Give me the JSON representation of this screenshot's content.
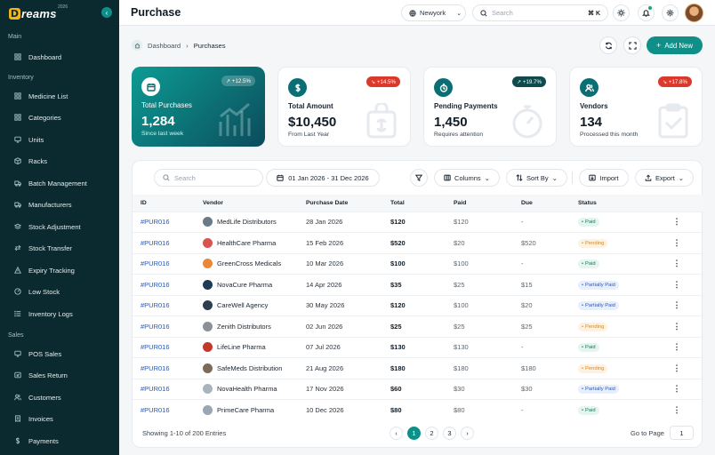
{
  "brand": {
    "name": "reams",
    "mark": "D",
    "year": "2026"
  },
  "sidebar": {
    "sections": [
      {
        "label": "Main",
        "items": [
          {
            "label": "Dashboard",
            "icon": "grid-icon"
          }
        ]
      },
      {
        "label": "Inventory",
        "items": [
          {
            "label": "Medicine List",
            "icon": "grid-icon"
          },
          {
            "label": "Categories",
            "icon": "grid-icon"
          },
          {
            "label": "Units",
            "icon": "monitor-icon"
          },
          {
            "label": "Racks",
            "icon": "box-icon"
          },
          {
            "label": "Batch Management",
            "icon": "truck-icon"
          },
          {
            "label": "Manufacturers",
            "icon": "truck-icon"
          },
          {
            "label": "Stock Adjustment",
            "icon": "stack-icon"
          },
          {
            "label": "Stock Transfer",
            "icon": "swap-icon"
          },
          {
            "label": "Expiry Tracking",
            "icon": "warning-icon"
          },
          {
            "label": "Low Stock",
            "icon": "gauge-icon"
          },
          {
            "label": "Inventory Logs",
            "icon": "list-icon"
          }
        ]
      },
      {
        "label": "Sales",
        "items": [
          {
            "label": "POS Sales",
            "icon": "monitor-icon"
          },
          {
            "label": "Sales Return",
            "icon": "return-icon"
          },
          {
            "label": "Customers",
            "icon": "users-icon"
          },
          {
            "label": "Invoices",
            "icon": "invoice-icon"
          },
          {
            "label": "Payments",
            "icon": "dollar-icon"
          }
        ]
      }
    ]
  },
  "topbar": {
    "title": "Purchase",
    "location": "Newyork",
    "search_placeholder": "Search",
    "shortcut": "⌘ K"
  },
  "breadcrumb": {
    "root": "Dashboard",
    "current": "Purchases"
  },
  "actions": {
    "add_label": "Add New"
  },
  "cards": [
    {
      "label": "Total Purchases",
      "value": "1,284",
      "sub": "Since last week",
      "badge": "↗ +12.5%",
      "trend": "up",
      "icon": "calendar-icon",
      "watermark": "chart-icon"
    },
    {
      "label": "Total Amount",
      "value": "$10,450",
      "sub": "From Last Year",
      "badge": "↘ +14.5%",
      "trend": "down",
      "icon": "dollar-icon",
      "watermark": "bag-icon"
    },
    {
      "label": "Pending Payments",
      "value": "1,450",
      "sub": "Requires attention",
      "badge": "↗ +19.7%",
      "trend": "up",
      "icon": "timer-icon",
      "watermark": "stopwatch-icon"
    },
    {
      "label": "Vendors",
      "value": "134",
      "sub": "Processed this month",
      "badge": "↘ +17.8%",
      "trend": "down",
      "icon": "users-icon",
      "watermark": "clipboard-icon"
    }
  ],
  "toolbar": {
    "search_placeholder": "Search",
    "date_range": "01 Jan 2026 - 31 Dec 2026",
    "columns_label": "Columns",
    "sort_label": "Sort By",
    "import_label": "Import",
    "export_label": "Export"
  },
  "table": {
    "headers": [
      "ID",
      "Vendor",
      "Purchase Date",
      "Total",
      "Paid",
      "Due",
      "Status"
    ],
    "rows": [
      {
        "id": "#PUR016",
        "vendor": "MedLife Distributors",
        "date": "28 Jan 2026",
        "total": "$120",
        "paid": "$120",
        "due": "-",
        "status": "Paid",
        "kind": "paid",
        "logo": "#6b7a88"
      },
      {
        "id": "#PUR016",
        "vendor": "HealthCare Pharma",
        "date": "15 Feb 2026",
        "total": "$520",
        "paid": "$20",
        "due": "$520",
        "status": "Pending",
        "kind": "pending",
        "logo": "#d9534f"
      },
      {
        "id": "#PUR016",
        "vendor": "GreenCross Medicals",
        "date": "10 Mar  2026",
        "total": "$100",
        "paid": "$100",
        "due": "-",
        "status": "Paid",
        "kind": "paid",
        "logo": "#e8893a"
      },
      {
        "id": "#PUR016",
        "vendor": "NovaCure Pharma",
        "date": "14 Apr 2026",
        "total": "$35",
        "paid": "$25",
        "due": "$15",
        "status": "Partially Paid",
        "kind": "partial",
        "logo": "#1f3b57"
      },
      {
        "id": "#PUR016",
        "vendor": "CareWell Agency",
        "date": "30 May 2026",
        "total": "$120",
        "paid": "$100",
        "due": "$20",
        "status": "Partially Paid",
        "kind": "partial",
        "logo": "#2d3e4f"
      },
      {
        "id": "#PUR016",
        "vendor": "Zenith Distributors",
        "date": "02 Jun 2026",
        "total": "$25",
        "paid": "$25",
        "due": "$25",
        "status": "Pending",
        "kind": "pending",
        "logo": "#8a9199"
      },
      {
        "id": "#PUR016",
        "vendor": "LifeLine Pharma",
        "date": "07 Jul 2026",
        "total": "$130",
        "paid": "$130",
        "due": "-",
        "status": "Paid",
        "kind": "paid",
        "logo": "#c0392b"
      },
      {
        "id": "#PUR016",
        "vendor": "SafeMeds Distribution",
        "date": "21 Aug 2026",
        "total": "$180",
        "paid": "$180",
        "due": "$180",
        "status": "Pending",
        "kind": "pending",
        "logo": "#7d6b5a"
      },
      {
        "id": "#PUR016",
        "vendor": "NovaHealth Pharma",
        "date": "17 Nov 2026",
        "total": "$60",
        "paid": "$30",
        "due": "$30",
        "status": "Partially Paid",
        "kind": "partial",
        "logo": "#a9b4bf"
      },
      {
        "id": "#PUR016",
        "vendor": "PrimeCare Pharma",
        "date": "10 Dec 2026",
        "total": "$80",
        "paid": "$80",
        "due": "-",
        "status": "Paid",
        "kind": "paid",
        "logo": "#9aa6b2"
      }
    ]
  },
  "footer": {
    "showing": "Showing 1-10 of 200 Entries",
    "pages": [
      "1",
      "2",
      "3"
    ],
    "prev": "‹",
    "next": "›",
    "goto_label": "Go to Page",
    "goto_value": "1"
  },
  "colors": {
    "accent": "#0e8f88",
    "sidebar": "#0b2a2f",
    "link": "#1d57c4"
  }
}
